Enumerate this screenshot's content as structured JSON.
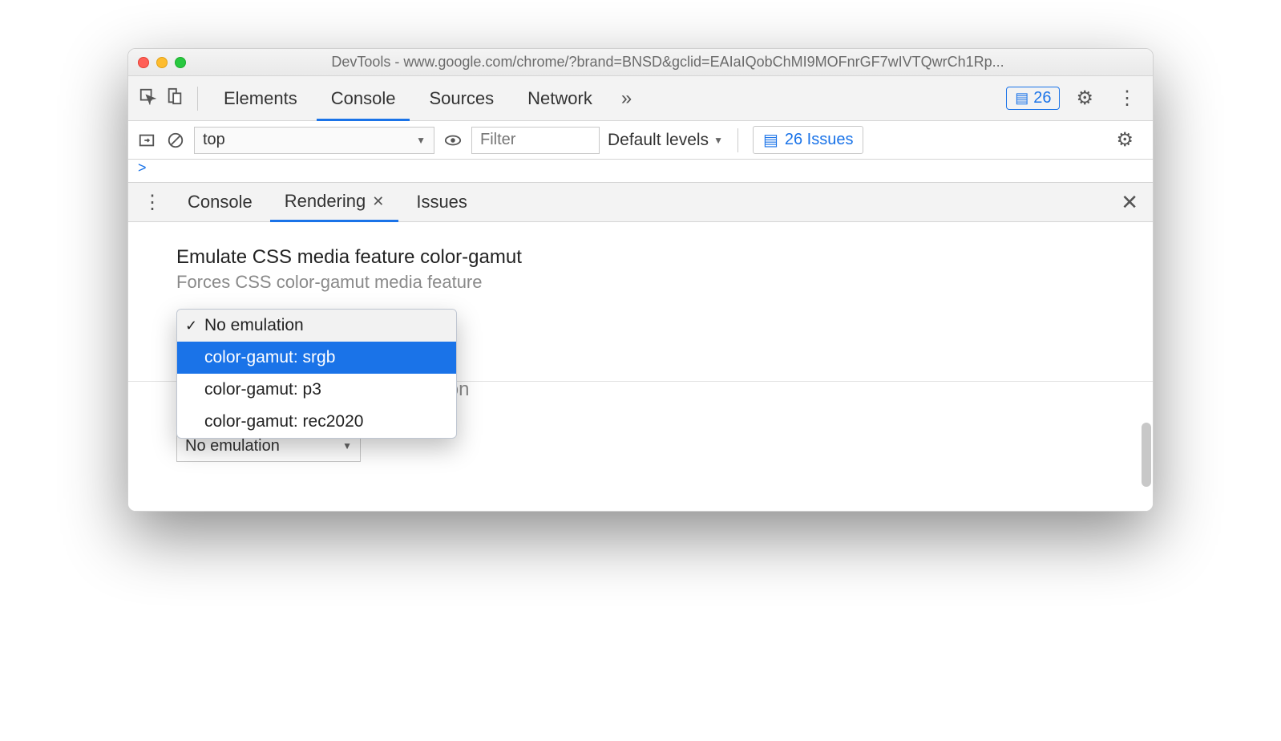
{
  "window": {
    "title": "DevTools - www.google.com/chrome/?brand=BNSD&gclid=EAIaIQobChMI9MOFnrGF7wIVTQwrCh1Rp..."
  },
  "toolbar": {
    "tabs": [
      "Elements",
      "Console",
      "Sources",
      "Network"
    ],
    "active_index": 1,
    "issue_count": "26"
  },
  "console_toolbar": {
    "context": "top",
    "filter_placeholder": "Filter",
    "levels_label": "Default levels",
    "issues_label": "26 Issues"
  },
  "drawer": {
    "tabs": [
      "Console",
      "Rendering",
      "Issues"
    ],
    "active_index": 1
  },
  "rendering": {
    "color_gamut_title": "Emulate CSS media feature color-gamut",
    "color_gamut_sub": "Forces CSS color-gamut media feature",
    "dropdown_options": [
      "No emulation",
      "color-gamut: srgb",
      "color-gamut: p3",
      "color-gamut: rec2020"
    ],
    "dropdown_checked_index": 0,
    "dropdown_hover_index": 1,
    "vision_peek": "Forces vision deficiency emulation",
    "vision_select_value": "No emulation"
  },
  "prompt": ">"
}
